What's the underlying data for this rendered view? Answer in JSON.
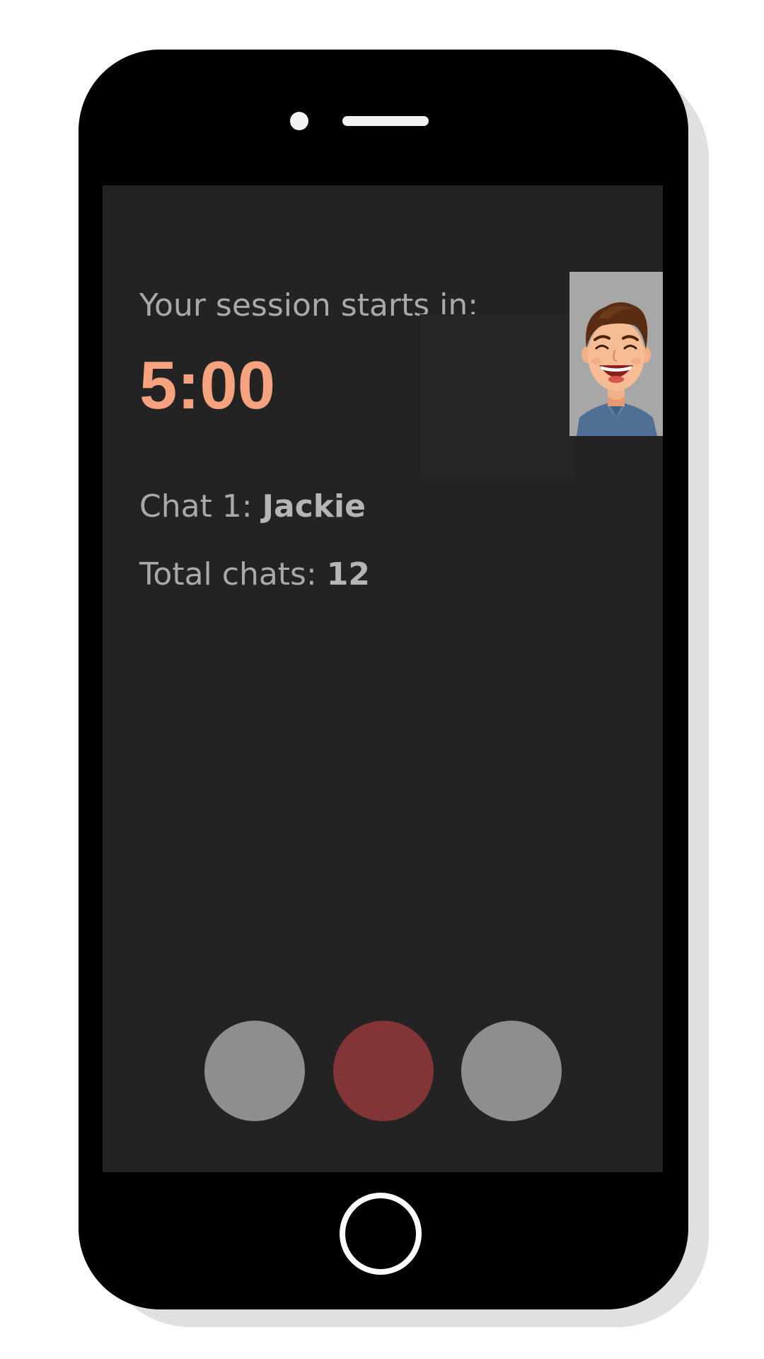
{
  "session": {
    "label": "Your session starts in:",
    "countdown": "5:00"
  },
  "chat": {
    "label": "Chat 1: ",
    "name": "Jackie"
  },
  "totals": {
    "label": "Total chats: ",
    "count": "12"
  },
  "avatar": {
    "icon": "cartoon-man-avatar"
  },
  "controls": [
    {
      "icon": "control-button-left",
      "color": "#8e8e8e"
    },
    {
      "icon": "control-button-end",
      "color": "#823436"
    },
    {
      "icon": "control-button-right",
      "color": "#8e8e8e"
    }
  ],
  "colors": {
    "screen_bg": "#232323",
    "countdown": "#f6a27e",
    "text": "#a9a9a9",
    "end_button": "#823436",
    "side_buttons": "#8e8e8e"
  }
}
